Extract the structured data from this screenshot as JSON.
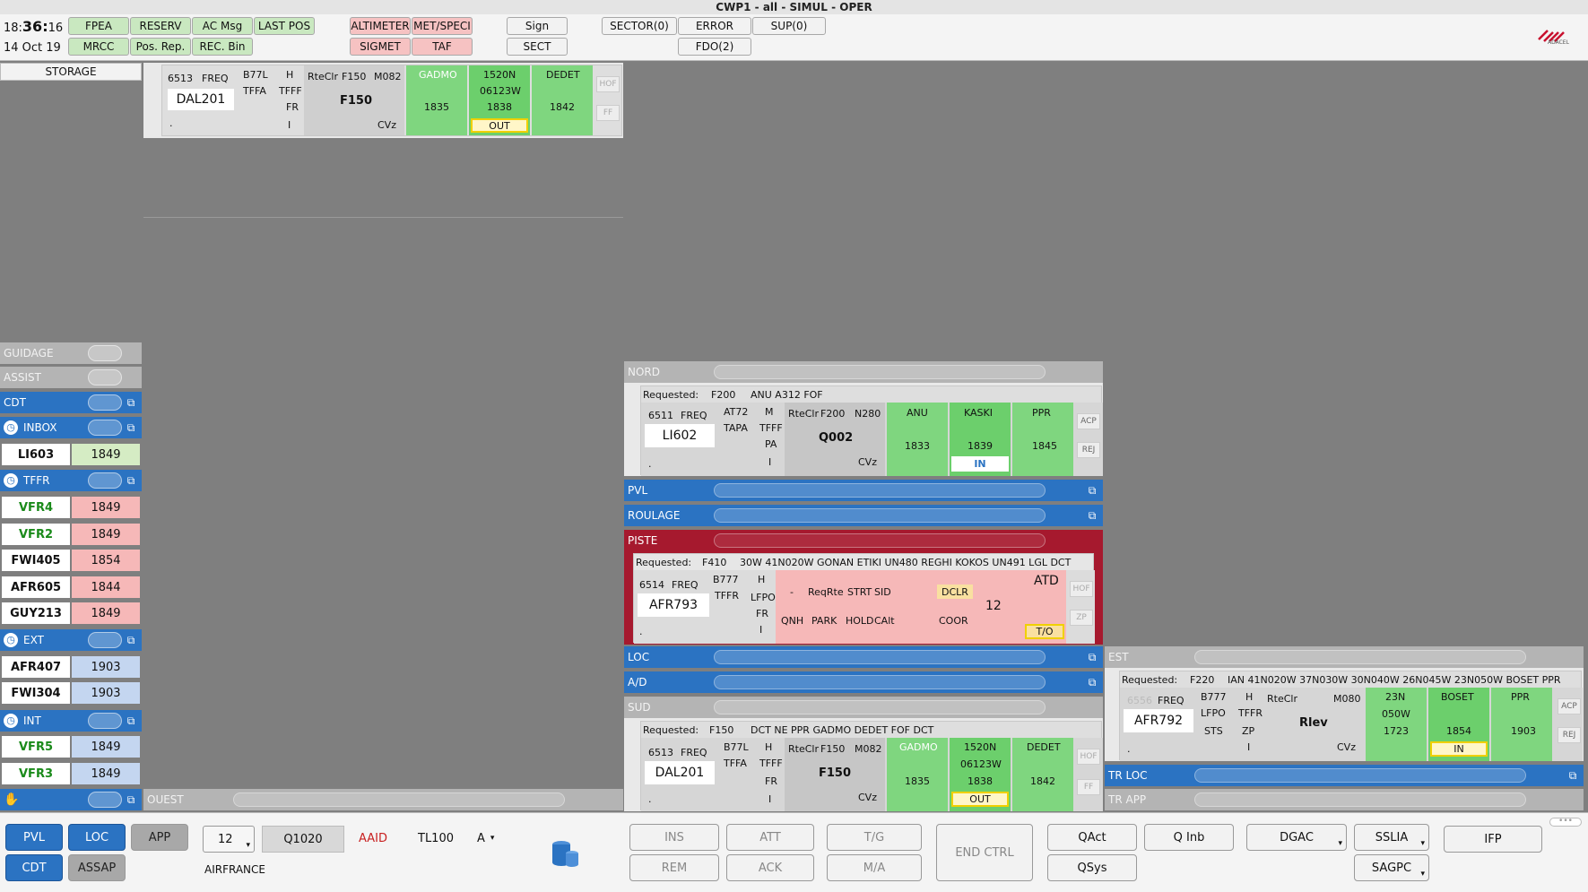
{
  "window": {
    "title": "CWP1 - all - SIMUL - OPER"
  },
  "clock": {
    "hhmm_prefix": "18:",
    "hhmm_main": "36:",
    "seconds": "16",
    "date": "14 Oct 19"
  },
  "toolbar": {
    "green_row1": [
      "FPEA",
      "RESERV",
      "AC Msg",
      "LAST POS"
    ],
    "green_row2": [
      "MRCC",
      "Pos. Rep.",
      "REC. Bin"
    ],
    "pink_row1": [
      "ALTIMETER",
      "MET/SPECI"
    ],
    "pink_row2": [
      "SIGMET",
      "TAF"
    ],
    "sign": "Sign",
    "sect": "SECT",
    "sector": "SECTOR(0)",
    "error": "ERROR",
    "sup": "SUP(0)",
    "fdo": "FDO(2)"
  },
  "logo": "ADACEL",
  "storage": {
    "label": "STORAGE"
  },
  "storage_strip": {
    "code": "6513",
    "freq": "FREQ",
    "callsign": "DAL201",
    "type": "B77L",
    "wake": "H",
    "dep": "TFFA",
    "arr": "TFFF",
    "rules": "FR",
    "flag": "I",
    "dot": ".",
    "rteclr": "RteClr",
    "rfl": "F150",
    "speed": "M082",
    "cfl": "F150",
    "cvz": "CVz",
    "fix1": "GADMO",
    "fix1_time": "1835",
    "fix2a": "1520N",
    "fix2b": "06123W",
    "fix2_time": "1838",
    "fix2_status": "OUT",
    "fix3": "DEDET",
    "fix3_time": "1842",
    "hof": "HOF",
    "ff": "FF"
  },
  "left": {
    "guidage": "GUIDAGE",
    "assist": "ASSIST",
    "cdt": "CDT",
    "inbox": "INBOX",
    "tffr": "TFFR",
    "ext": "EXT",
    "int": "INT",
    "inbox_items": [
      {
        "cs": "LI603",
        "tm": "1849"
      }
    ],
    "tffr_items": [
      {
        "cs": "VFR4",
        "tm": "1849"
      },
      {
        "cs": "VFR2",
        "tm": "1849"
      },
      {
        "cs": "FWI405",
        "tm": "1854"
      },
      {
        "cs": "AFR605",
        "tm": "1844"
      },
      {
        "cs": "GUY213",
        "tm": "1849"
      }
    ],
    "ext_items": [
      {
        "cs": "AFR407",
        "tm": "1903"
      },
      {
        "cs": "FWI304",
        "tm": "1903"
      }
    ],
    "int_items": [
      {
        "cs": "VFR5",
        "tm": "1849"
      },
      {
        "cs": "VFR3",
        "tm": "1849"
      }
    ]
  },
  "bays": {
    "ouest": "OUEST",
    "nord": "NORD",
    "pvl": "PVL",
    "roulage": "ROULAGE",
    "piste": "PISTE",
    "loc": "LOC",
    "ad": "A/D",
    "sud": "SUD",
    "est": "EST",
    "trloc": "TR LOC",
    "trapp": "TR APP"
  },
  "nord_strip": {
    "requested": "Requested:",
    "req_fl": "F200",
    "req_route": "ANU A312 FOF",
    "code": "6511",
    "freq": "FREQ",
    "callsign": "LI602",
    "type": "AT72",
    "wake": "M",
    "dep": "TAPA",
    "arr": "TFFF",
    "rules": "PA",
    "flag": "I",
    "dot": ".",
    "rteclr": "RteClr",
    "rfl": "F200",
    "speed": "N280",
    "route": "Q002",
    "cvz": "CVz",
    "fix1": "ANU",
    "fix1_time": "1833",
    "fix2": "KASKI",
    "fix2_time": "1839",
    "fix2_status": "IN",
    "fix3": "PPR",
    "fix3_time": "1845",
    "acp": "ACP",
    "rej": "REJ"
  },
  "piste_strip": {
    "requested": "Requested:",
    "req_fl": "F410",
    "req_route": "30W 41N020W GONAN ETIKI UN480 REGHI KOKOS UN491 LGL DCT",
    "code": "6514",
    "freq": "FREQ",
    "callsign": "AFR793",
    "type": "B777",
    "wake": "H",
    "dep": "TFFR",
    "arr": "LFPO",
    "rules": "FR",
    "flag": "I",
    "dot": ".",
    "dash": "-",
    "reqrte": "ReqRte",
    "strt": "STRT",
    "sid": "SID",
    "dclr": "DCLR",
    "qnh": "QNH",
    "park": "PARK",
    "hold": "HOLD",
    "calt": "CAlt",
    "coor": "COOR",
    "rwy": "12",
    "atd": "ATD",
    "to": "T/O",
    "hof": "HOF",
    "zp": "ZP"
  },
  "sud_strip": {
    "requested": "Requested:",
    "req_fl": "F150",
    "req_route": "DCT NE PPR GADMO DEDET FOF DCT",
    "code": "6513",
    "freq": "FREQ",
    "callsign": "DAL201",
    "type": "B77L",
    "wake": "H",
    "dep": "TFFA",
    "arr": "TFFF",
    "rules": "FR",
    "flag": "I",
    "dot": ".",
    "rteclr": "RteClr",
    "rfl": "F150",
    "speed": "M082",
    "cfl": "F150",
    "cvz": "CVz",
    "fix1": "GADMO",
    "fix1_time": "1835",
    "fix2a": "1520N",
    "fix2b": "06123W",
    "fix2_time": "1838",
    "fix2_status": "OUT",
    "fix3": "DEDET",
    "fix3_time": "1842",
    "hof": "HOF",
    "ff": "FF"
  },
  "est_strip": {
    "requested": "Requested:",
    "req_fl": "F220",
    "req_route": "IAN 41N020W 37N030W 30N040W 26N045W 23N050W BOSET PPR",
    "code": "6556",
    "freq": "FREQ",
    "callsign": "AFR792",
    "type": "B777",
    "wake": "H",
    "dep": "LFPO",
    "arr": "TFFR",
    "rules": "STS",
    "zp": "ZP",
    "flag": "I",
    "dot": ".",
    "rteclr": "RteClr",
    "speed": "M080",
    "route": "Rlev",
    "cvz": "CVz",
    "fix1a": "23N",
    "fix1b": "050W",
    "fix1_time": "1723",
    "fix2": "BOSET",
    "fix2_time": "1854",
    "fix2_status": "IN",
    "fix3": "PPR",
    "fix3_time": "1903",
    "acp": "ACP",
    "rej": "REJ"
  },
  "bottom": {
    "pvl": "PVL",
    "loc": "LOC",
    "app": "APP",
    "cdt": "CDT",
    "assap": "ASSAP",
    "rwy": "12",
    "qnh": "Q1020",
    "aaid": "AAID",
    "tl": "TL100",
    "a": "A",
    "airline": "AIRFRANCE",
    "ins": "INS",
    "att": "ATT",
    "tg": "T/G",
    "endctrl": "END CTRL",
    "rem": "REM",
    "ack": "ACK",
    "ma": "M/A",
    "qact": "QAct",
    "qinb": "Q Inb",
    "qsys": "QSys",
    "dgac": "DGAC",
    "sslia": "SSLIA",
    "sagpc": "SAGPC",
    "ifp": "IFP"
  },
  "colors": {
    "bay_blue": "#2b73c2",
    "bay_red": "#a6192e",
    "green_cell": "#7fd67f",
    "pink_cell": "#f6b8b8"
  }
}
